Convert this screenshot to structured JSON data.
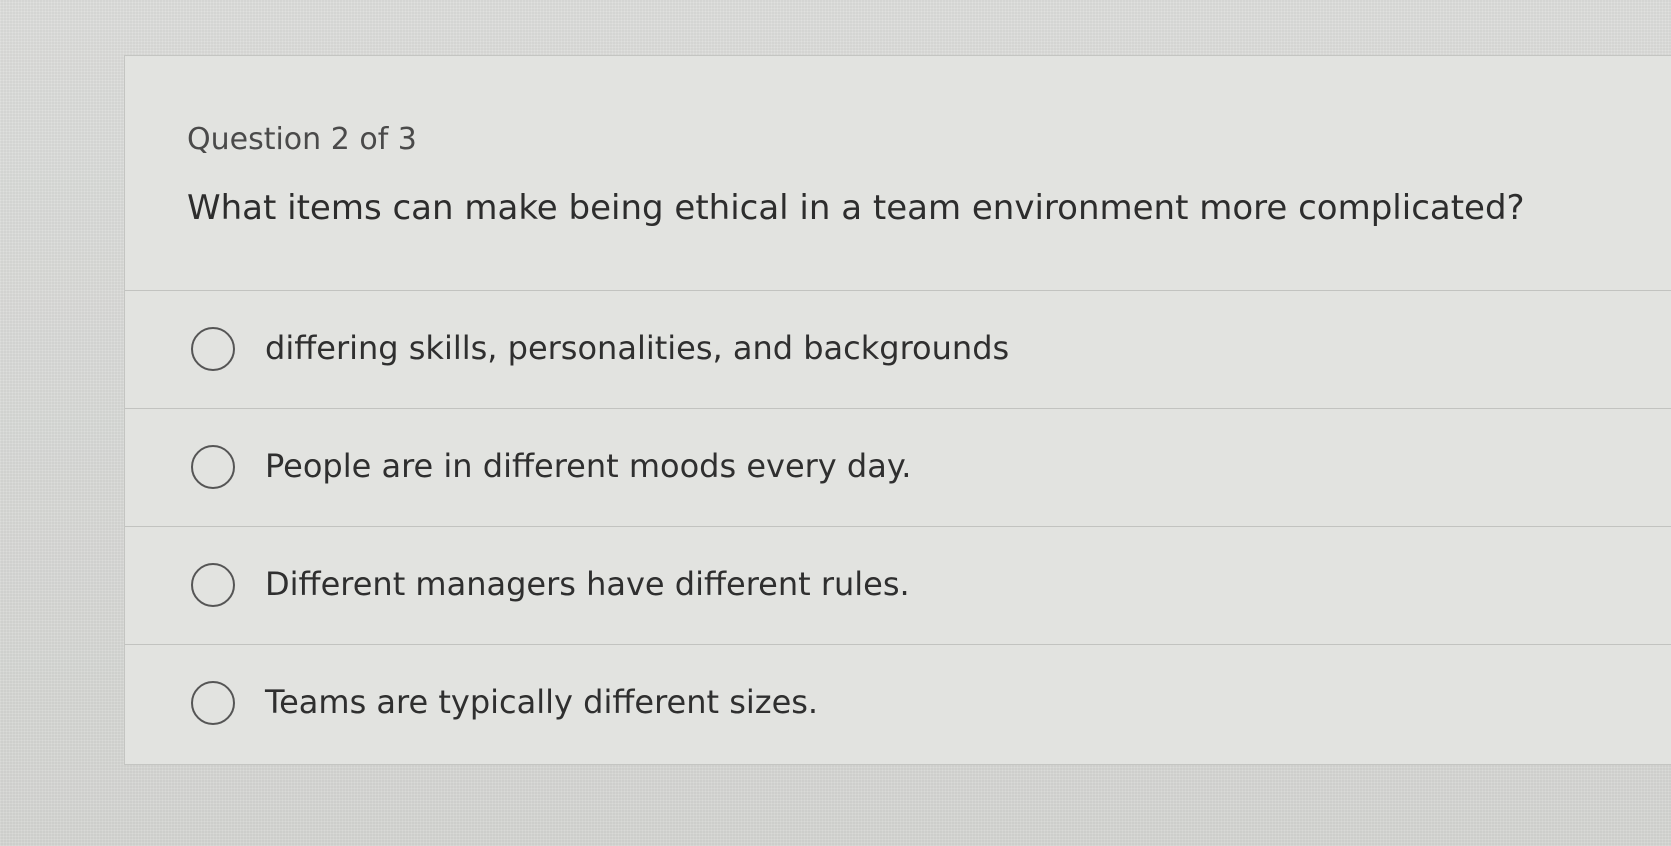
{
  "question": {
    "counter": "Question 2 of 3",
    "text": "What items can make being ethical in a team environment more complicated?"
  },
  "answers": [
    {
      "label": "differing skills, personalities, and backgrounds",
      "selected": false
    },
    {
      "label": "People are in different moods every day.",
      "selected": false
    },
    {
      "label": "Different managers have different rules.",
      "selected": false
    },
    {
      "label": "Teams are typically different sizes.",
      "selected": false
    }
  ],
  "colors": {
    "background": "#d9dad6",
    "card": "#e2e3e0",
    "text": "#2d2d2d",
    "divider": "#c2c3c0"
  }
}
